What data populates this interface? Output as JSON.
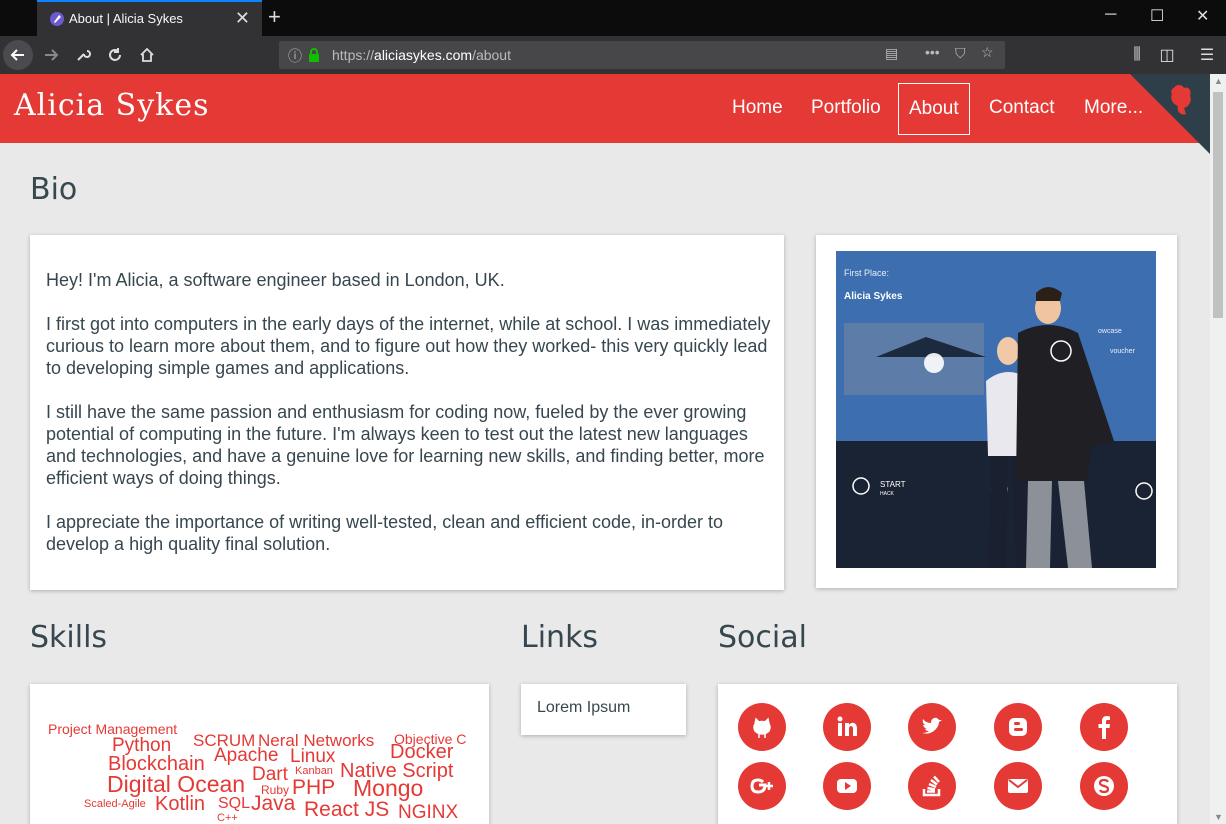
{
  "browser": {
    "tab_title": "About | Alicia Sykes",
    "url_scheme": "https://",
    "url_host": "aliciasykes.com",
    "url_path": "/about"
  },
  "site": {
    "brand": "Alicia Sykes",
    "nav": [
      "Home",
      "Portfolio",
      "About",
      "Contact",
      "More..."
    ],
    "active_nav": "About"
  },
  "bio": {
    "title": "Bio",
    "paragraphs": [
      "Hey! I'm Alicia, a software engineer based in London, UK.",
      "I first got into computers in the early days of the internet, while at school. I was immediately curious to learn more about them, and to figure out how they worked- this very quickly lead to developing simple games and applications.",
      "I still have the same passion and enthusiasm for coding now, fueled by the ever growing potential of computing in the future. I'm always keen to test out the latest new languages and technologies, and have a genuine love for learning new skills, and finding better, more efficient ways of doing things.",
      "I appreciate the importance of writing well-tested, clean and efficient code, in-order to develop a high quality final solution."
    ],
    "photo": {
      "caption_line1": "First Place:",
      "caption_line2": "Alicia Sykes",
      "side_text1": "owcase",
      "side_text2": "voucher",
      "logo_text1": "START",
      "logo_text2": "HACK"
    }
  },
  "skills": {
    "title": "Skills",
    "words": [
      "Project Management",
      "Python",
      "SCRUM",
      "Neral Networks",
      "Objective C",
      "Blockchain",
      "Apache",
      "Linux",
      "Docker",
      "Digital Ocean",
      "Dart",
      "Kanban",
      "Native Script",
      "Ruby",
      "PHP",
      "Mongo",
      "Scaled-Agile",
      "Kotlin",
      "SQL",
      "Java",
      "React JS",
      "NGINX",
      "C++"
    ]
  },
  "links": {
    "title": "Links",
    "items": [
      "Lorem Ipsum"
    ]
  },
  "social": {
    "title": "Social",
    "icons": [
      "github-icon",
      "linkedin-icon",
      "twitter-icon",
      "blogger-icon",
      "facebook-icon",
      "google-plus-icon",
      "youtube-icon",
      "stackoverflow-icon",
      "email-icon",
      "skype-icon"
    ]
  },
  "colors": {
    "accent": "#e53935",
    "text": "#37474f",
    "background": "#e9e9e9"
  }
}
